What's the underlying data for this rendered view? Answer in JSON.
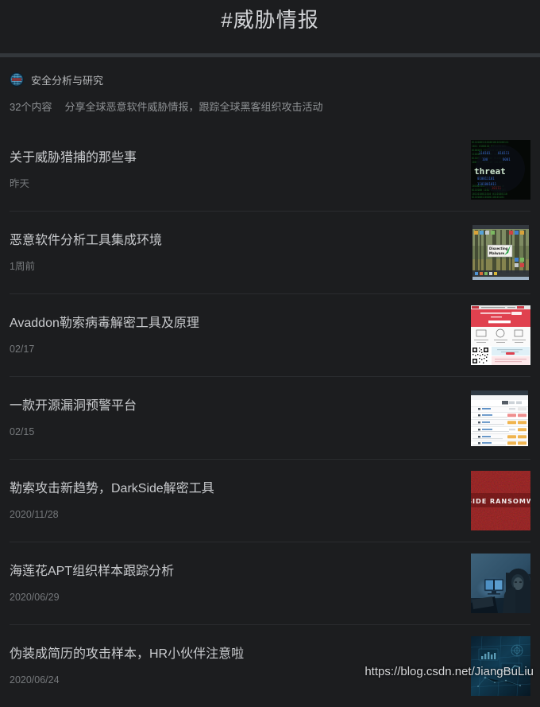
{
  "header": {
    "title": "#威胁情报"
  },
  "collection": {
    "avatar_icon": "globe-avatar-icon",
    "author": "安全分析与研究",
    "count": "32个内容",
    "description": "分享全球恶意软件威胁情报，跟踪全球黑客组织攻击活动"
  },
  "posts": [
    {
      "title": "关于威胁猎捕的那些事",
      "date": "昨天",
      "thumb": "matrix-threat-thumbnail",
      "thumb_text": "threat"
    },
    {
      "title": "恶意软件分析工具集成环境",
      "date": "1周前",
      "thumb": "forest-desktop-thumbnail",
      "thumb_text": "Dissecting Malware"
    },
    {
      "title": "Avaddon勒索病毒解密工具及原理",
      "date": "02/17",
      "thumb": "red-webpage-qrcode-thumbnail",
      "thumb_text": ""
    },
    {
      "title": "一款开源漏洞预警平台",
      "date": "02/15",
      "thumb": "vulnerability-table-thumbnail",
      "thumb_text": ""
    },
    {
      "title": "勒索攻击新趋势，DarkSide解密工具",
      "date": "2020/11/28",
      "thumb": "dark-red-ransomware-thumbnail",
      "thumb_text": "SIDE RANSOMW"
    },
    {
      "title": "海莲花APT组织样本跟踪分析",
      "date": "2020/06/29",
      "thumb": "hooded-hacker-thumbnail",
      "thumb_text": ""
    },
    {
      "title": "伪装成简历的攻击样本，HR小伙伴注意啦",
      "date": "2020/06/24",
      "thumb": "blue-tech-data-thumbnail",
      "thumb_text": ""
    }
  ],
  "watermark": "https://blog.csdn.net/JiangBuLiu",
  "colors": {
    "background": "#1c1d1f",
    "divider_band": "#33373b",
    "row_separator": "#2a2c2f",
    "title_text": "#c9cbce",
    "meta_text": "#8e9194",
    "date_text": "#76797c"
  }
}
